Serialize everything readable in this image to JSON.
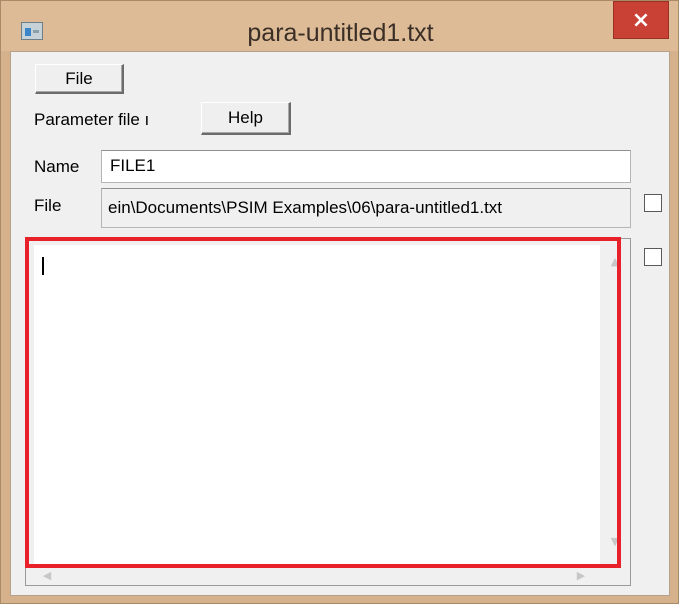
{
  "window": {
    "title": "para-untitled1.txt",
    "close_glyph": "×"
  },
  "toolbar": {
    "file_label": "File",
    "help_label": "Help"
  },
  "form": {
    "parameter_label": "Parameter file ı",
    "name_label": "Name",
    "name_value": "FILE1",
    "file_label": "File",
    "file_path": "ein\\Documents\\PSIM Examples\\06\\para-untitled1.txt"
  },
  "editor": {
    "content": ""
  },
  "icons": {
    "app": "app-window-icon",
    "close": "close-icon",
    "scroll_up": "chevron-up-icon",
    "scroll_down": "chevron-down-icon",
    "scroll_left": "chevron-left-icon",
    "scroll_right": "chevron-right-icon"
  },
  "colors": {
    "highlight": "#e8202a",
    "close_button": "#c94034",
    "title_bar": "#dcbb96"
  }
}
